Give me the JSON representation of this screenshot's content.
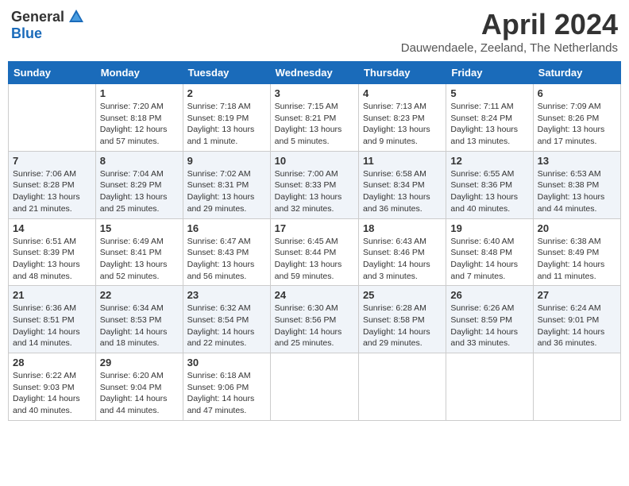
{
  "header": {
    "logo_general": "General",
    "logo_blue": "Blue",
    "month_title": "April 2024",
    "location": "Dauwendaele, Zeeland, The Netherlands"
  },
  "calendar": {
    "days_of_week": [
      "Sunday",
      "Monday",
      "Tuesday",
      "Wednesday",
      "Thursday",
      "Friday",
      "Saturday"
    ],
    "weeks": [
      [
        {
          "day": "",
          "info": ""
        },
        {
          "day": "1",
          "info": "Sunrise: 7:20 AM\nSunset: 8:18 PM\nDaylight: 12 hours\nand 57 minutes."
        },
        {
          "day": "2",
          "info": "Sunrise: 7:18 AM\nSunset: 8:19 PM\nDaylight: 13 hours\nand 1 minute."
        },
        {
          "day": "3",
          "info": "Sunrise: 7:15 AM\nSunset: 8:21 PM\nDaylight: 13 hours\nand 5 minutes."
        },
        {
          "day": "4",
          "info": "Sunrise: 7:13 AM\nSunset: 8:23 PM\nDaylight: 13 hours\nand 9 minutes."
        },
        {
          "day": "5",
          "info": "Sunrise: 7:11 AM\nSunset: 8:24 PM\nDaylight: 13 hours\nand 13 minutes."
        },
        {
          "day": "6",
          "info": "Sunrise: 7:09 AM\nSunset: 8:26 PM\nDaylight: 13 hours\nand 17 minutes."
        }
      ],
      [
        {
          "day": "7",
          "info": "Sunrise: 7:06 AM\nSunset: 8:28 PM\nDaylight: 13 hours\nand 21 minutes."
        },
        {
          "day": "8",
          "info": "Sunrise: 7:04 AM\nSunset: 8:29 PM\nDaylight: 13 hours\nand 25 minutes."
        },
        {
          "day": "9",
          "info": "Sunrise: 7:02 AM\nSunset: 8:31 PM\nDaylight: 13 hours\nand 29 minutes."
        },
        {
          "day": "10",
          "info": "Sunrise: 7:00 AM\nSunset: 8:33 PM\nDaylight: 13 hours\nand 32 minutes."
        },
        {
          "day": "11",
          "info": "Sunrise: 6:58 AM\nSunset: 8:34 PM\nDaylight: 13 hours\nand 36 minutes."
        },
        {
          "day": "12",
          "info": "Sunrise: 6:55 AM\nSunset: 8:36 PM\nDaylight: 13 hours\nand 40 minutes."
        },
        {
          "day": "13",
          "info": "Sunrise: 6:53 AM\nSunset: 8:38 PM\nDaylight: 13 hours\nand 44 minutes."
        }
      ],
      [
        {
          "day": "14",
          "info": "Sunrise: 6:51 AM\nSunset: 8:39 PM\nDaylight: 13 hours\nand 48 minutes."
        },
        {
          "day": "15",
          "info": "Sunrise: 6:49 AM\nSunset: 8:41 PM\nDaylight: 13 hours\nand 52 minutes."
        },
        {
          "day": "16",
          "info": "Sunrise: 6:47 AM\nSunset: 8:43 PM\nDaylight: 13 hours\nand 56 minutes."
        },
        {
          "day": "17",
          "info": "Sunrise: 6:45 AM\nSunset: 8:44 PM\nDaylight: 13 hours\nand 59 minutes."
        },
        {
          "day": "18",
          "info": "Sunrise: 6:43 AM\nSunset: 8:46 PM\nDaylight: 14 hours\nand 3 minutes."
        },
        {
          "day": "19",
          "info": "Sunrise: 6:40 AM\nSunset: 8:48 PM\nDaylight: 14 hours\nand 7 minutes."
        },
        {
          "day": "20",
          "info": "Sunrise: 6:38 AM\nSunset: 8:49 PM\nDaylight: 14 hours\nand 11 minutes."
        }
      ],
      [
        {
          "day": "21",
          "info": "Sunrise: 6:36 AM\nSunset: 8:51 PM\nDaylight: 14 hours\nand 14 minutes."
        },
        {
          "day": "22",
          "info": "Sunrise: 6:34 AM\nSunset: 8:53 PM\nDaylight: 14 hours\nand 18 minutes."
        },
        {
          "day": "23",
          "info": "Sunrise: 6:32 AM\nSunset: 8:54 PM\nDaylight: 14 hours\nand 22 minutes."
        },
        {
          "day": "24",
          "info": "Sunrise: 6:30 AM\nSunset: 8:56 PM\nDaylight: 14 hours\nand 25 minutes."
        },
        {
          "day": "25",
          "info": "Sunrise: 6:28 AM\nSunset: 8:58 PM\nDaylight: 14 hours\nand 29 minutes."
        },
        {
          "day": "26",
          "info": "Sunrise: 6:26 AM\nSunset: 8:59 PM\nDaylight: 14 hours\nand 33 minutes."
        },
        {
          "day": "27",
          "info": "Sunrise: 6:24 AM\nSunset: 9:01 PM\nDaylight: 14 hours\nand 36 minutes."
        }
      ],
      [
        {
          "day": "28",
          "info": "Sunrise: 6:22 AM\nSunset: 9:03 PM\nDaylight: 14 hours\nand 40 minutes."
        },
        {
          "day": "29",
          "info": "Sunrise: 6:20 AM\nSunset: 9:04 PM\nDaylight: 14 hours\nand 44 minutes."
        },
        {
          "day": "30",
          "info": "Sunrise: 6:18 AM\nSunset: 9:06 PM\nDaylight: 14 hours\nand 47 minutes."
        },
        {
          "day": "",
          "info": ""
        },
        {
          "day": "",
          "info": ""
        },
        {
          "day": "",
          "info": ""
        },
        {
          "day": "",
          "info": ""
        }
      ]
    ]
  }
}
